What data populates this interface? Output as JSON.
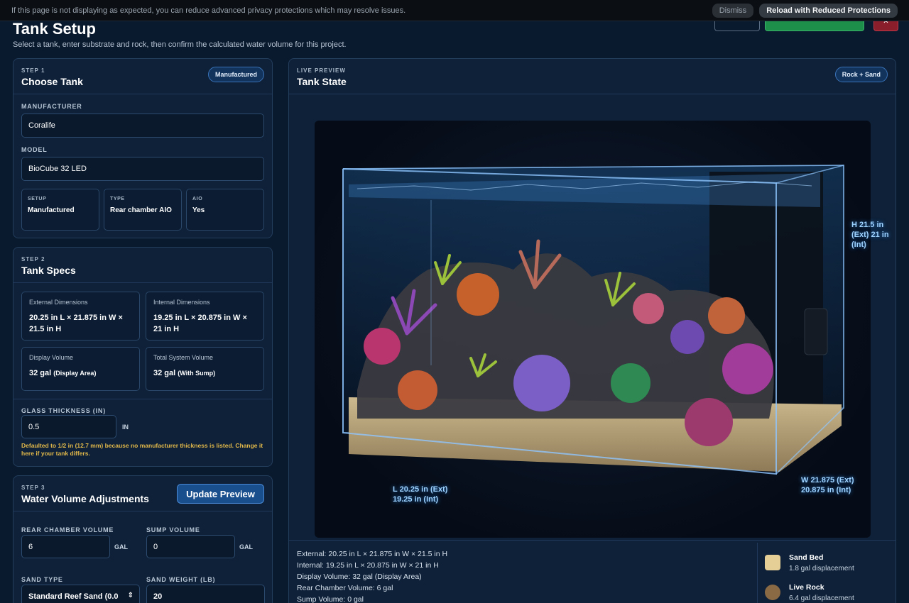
{
  "banner": {
    "text": "If this page is not displaying as expected, you can reduce advanced privacy protections which may resolve issues.",
    "dismiss": "Dismiss",
    "reload": "Reload with Reduced Protections"
  },
  "page": {
    "title": "Tank Setup",
    "subtitle": "Select a tank, enter substrate and rock, then confirm the calculated water volume for this project.",
    "close_glyph": "✕"
  },
  "step1": {
    "step": "STEP 1",
    "title": "Choose Tank",
    "badge": "Manufactured",
    "manufacturer_label": "MANUFACTURER",
    "manufacturer_value": "Coralife",
    "model_label": "MODEL",
    "model_value": "BioCube 32 LED",
    "setup_label": "SETUP",
    "setup_value": "Manufactured",
    "type_label": "TYPE",
    "type_value": "Rear chamber AIO",
    "aio_label": "AIO",
    "aio_value": "Yes"
  },
  "step2": {
    "step": "STEP 2",
    "title": "Tank Specs",
    "ext_label": "External Dimensions",
    "ext_value": "20.25 in L × 21.875 in W × 21.5 in H",
    "int_label": "Internal Dimensions",
    "int_value": "19.25 in L × 20.875 in W × 21 in H",
    "display_label": "Display Volume",
    "display_value": "32 gal",
    "display_note": "(Display Area)",
    "total_label": "Total System Volume",
    "total_value": "32 gal",
    "total_note": "(With Sump)",
    "glass_label": "GLASS THICKNESS (IN)",
    "glass_value": "0.5",
    "glass_unit": "IN",
    "glass_note": "Defaulted to 1/2 in (12.7 mm) because no manufacturer thickness is listed. Change it here if your tank differs."
  },
  "step3": {
    "step": "STEP 3",
    "title": "Water Volume Adjustments",
    "update_button": "Update Preview",
    "rear_label": "REAR CHAMBER VOLUME",
    "rear_value": "6",
    "rear_unit": "GAL",
    "sump_label": "SUMP VOLUME",
    "sump_value": "0",
    "sump_unit": "GAL",
    "sand_type_label": "SAND TYPE",
    "sand_type_value": "Standard Reef Sand (0.0",
    "sand_weight_label": "SAND WEIGHT (LB)",
    "sand_weight_value": "20"
  },
  "preview": {
    "step": "LIVE PREVIEW",
    "title": "Tank State",
    "badge": "Rock + Sand",
    "height_label": "H 21.5 in (Ext) 21 in (Int)",
    "length_label_1": "L 20.25 in (Ext)",
    "length_label_2": "19.25 in (Int)",
    "width_label_1": "W 21.875 (Ext)",
    "width_label_2": "20.875 in (Int)",
    "stats": [
      "External: 20.25 in L × 21.875 in W × 21.5 in H",
      "Internal: 19.25 in L × 20.875 in W × 21 in H",
      "Display Volume: 32 gal (Display Area)",
      "Rear Chamber Volume: 6 gal",
      "Sump Volume: 0 gal"
    ],
    "legend": [
      {
        "name": "Sand Bed",
        "sub": "1.8 gal displacement",
        "color": "#e6cf96"
      },
      {
        "name": "Live Rock",
        "sub": "6.4 gal displacement",
        "color": "#8a6a45"
      }
    ]
  }
}
